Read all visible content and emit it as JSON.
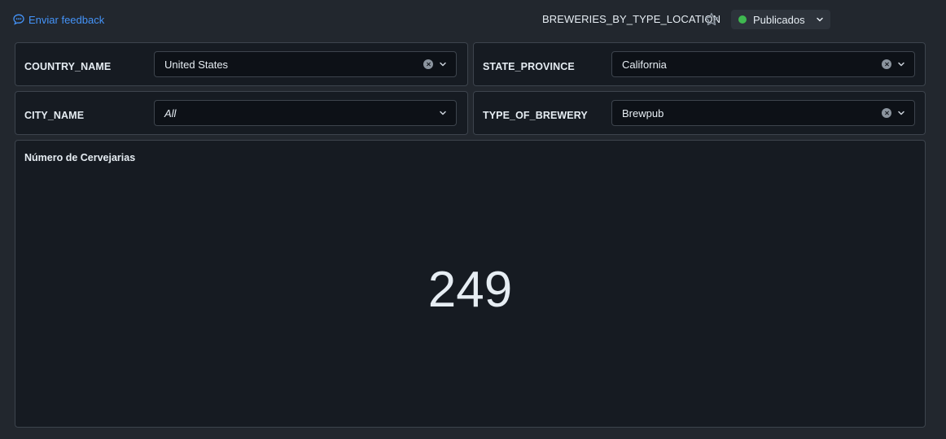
{
  "header": {
    "feedback_label": "Enviar feedback",
    "dashboard_title": "BREWERIES_BY_TYPE_LOCATION",
    "status_label": "Publicados",
    "status_color": "#3fb950",
    "accent_color": "#4493f8"
  },
  "filters": [
    {
      "label": "COUNTRY_NAME",
      "value": "United States"
    },
    {
      "label": "STATE_PROVINCE",
      "value": "California"
    },
    {
      "label": "CITY_NAME",
      "value": "All"
    },
    {
      "label": "TYPE_OF_BREWERY",
      "value": "Brewpub"
    }
  ],
  "counter": {
    "title": "Número de Cervejarias",
    "value": "249"
  }
}
